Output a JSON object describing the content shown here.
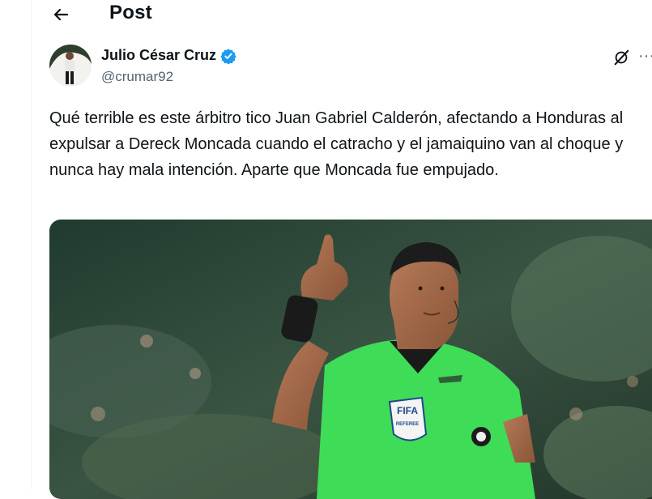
{
  "header": {
    "back_label": "←",
    "title": "Post"
  },
  "author": {
    "name": "Julio César Cruz",
    "handle": "@crumar92",
    "verified": true
  },
  "actions": {
    "grok_icon": "grok-icon",
    "more_label": "···"
  },
  "post": {
    "text": "Qué terrible es este árbitro tico Juan Gabriel Calderón, afectando a Honduras al expulsar a Dereck Moncada cuando el catracho y el jamaiquino van al choque y nunca hay mala intención. Aparte que Moncada fue empujado."
  },
  "media": {
    "badge_top": "FIFA",
    "badge_bottom": "REFEREE",
    "colors": {
      "jersey": "#3fdc57",
      "background": "#2f4a3c"
    }
  },
  "colors": {
    "verified": "#1d9bf0",
    "secondary_text": "#536471",
    "border": "#eff3f4"
  }
}
